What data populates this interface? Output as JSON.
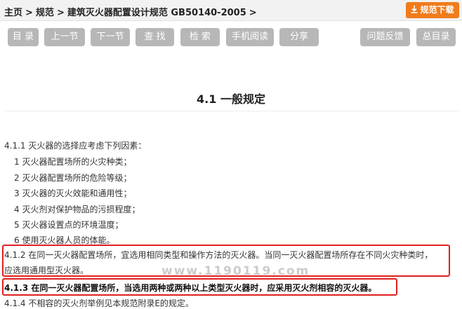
{
  "breadcrumb": {
    "home": "主页",
    "standards": "规范",
    "current": "建筑灭火器配置设计规范 GB50140-2005",
    "separator": ">"
  },
  "download": {
    "label": "规范下载",
    "icon": "download-icon",
    "color": "#f07c1b"
  },
  "toolbar": {
    "buttons": [
      "目 录",
      "上一节",
      "下一节",
      "查 找",
      "检 索",
      "手机阅读",
      "分享",
      "问题反馈",
      "总目录"
    ],
    "color": "#b7b7b7"
  },
  "section": {
    "title": "4.1 一般规定"
  },
  "content": {
    "p411_intro": "4.1.1 灭火器的选择应考虑下列因素：",
    "p411_items": [
      "1 灭火器配置场所的火灾种类；",
      "2 灭火器配置场所的危险等级；",
      "3 灭火器的灭火效能和通用性；",
      "4 灭火剂对保护物品的污损程度；",
      "5 灭火器设置点的环境温度；",
      "6 使用灭火器人员的体能。"
    ],
    "p412_line1": "4.1.2 在同一灭火器配置场所，宜选用相同类型和操作方法的灭火器。当同一灭火器配置场所存在不同火灾种类时，",
    "p412_line2": "应选用通用型灭火器。",
    "p413": "4.1.3 在同一灭火器配置场所，当选用两种或两种以上类型灭火器时，应采用灭火剂相容的灭火器。",
    "p414": "4.1.4 不相容的灭火剂举例见本规范附录E的规定。"
  },
  "watermark": "www.1190119.com",
  "highlight_color": "#e02020"
}
